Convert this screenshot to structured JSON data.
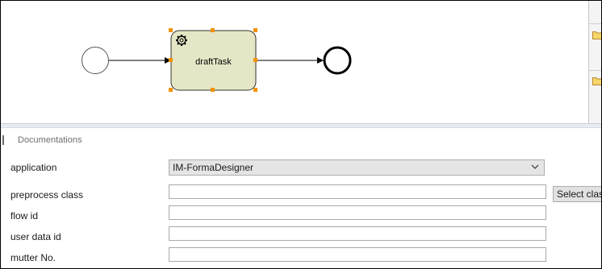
{
  "diagram": {
    "task_label": "draftTask"
  },
  "panel": {
    "section_title": "Documentations",
    "fields": {
      "application_label": "application",
      "application_value": "IM-FormaDesigner",
      "preprocess_label": "preprocess class",
      "preprocess_value": "",
      "select_class_button": "Select class",
      "flow_id_label": "flow id",
      "flow_id_value": "",
      "user_data_id_label": "user data id",
      "user_data_id_value": "",
      "mutter_label": "mutter No.",
      "mutter_value": ""
    }
  },
  "colors": {
    "task_fill": "#e5e6c5",
    "selection_handle": "#f39200"
  },
  "icons": [
    "gear-icon",
    "folder-icon",
    "chevron-down-icon"
  ]
}
